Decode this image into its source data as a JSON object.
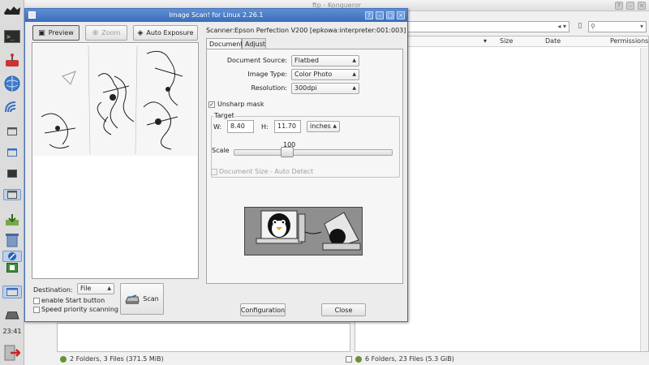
{
  "desktop": {
    "clock": "23:41",
    "panel_icons": [
      "app-icon",
      "terminal-icon",
      "joystick-icon",
      "globe-icon",
      "wifi-icon",
      "window-icon",
      "window-icon",
      "window-icon",
      "window-icon",
      "download-icon",
      "trash-icon",
      "scanner-icon",
      "browser-icon",
      "window-icon",
      "printer-icon",
      "logout-icon"
    ]
  },
  "konqueror": {
    "title": "ftp - Konqueror",
    "right_pane": {
      "columns": [
        "Size",
        "Date",
        "Permissions"
      ]
    },
    "status_left": "2 Folders, 3 Files (371.5 MiB)",
    "status_right": "6 Folders, 23 Files (5.3 GiB)"
  },
  "scan_dialog": {
    "title": "Image Scan! for Linux 2.26.1",
    "toolbar": {
      "preview": "Preview",
      "zoom": "Zoom",
      "auto_exposure": "Auto Exposure"
    },
    "scanner_label": "Scanner:",
    "scanner_value": "Epson Perfection V200 [epkowa:interpreter:001:003]",
    "tabs": [
      "Document",
      "Adjust"
    ],
    "document": {
      "source_label": "Document Source:",
      "source_value": "Flatbed",
      "type_label": "Image Type:",
      "type_value": "Color Photo",
      "resolution_label": "Resolution:",
      "resolution_value": "300dpi",
      "unsharp_label": "Unsharp mask",
      "unsharp_checked": true,
      "target_label": "Target",
      "w_label": "W:",
      "w_value": "8.40",
      "h_label": "H:",
      "h_value": "11.70",
      "unit_value": "inches",
      "scale_label": "Scale",
      "scale_value": "100",
      "autodetect_label": "Document Size - Auto Detect"
    },
    "destination_label": "Destination:",
    "destination_value": "File",
    "enable_start_label": "enable Start button",
    "speed_priority_label": "Speed priority scanning",
    "scan_button": "Scan",
    "configuration_button": "Configuration",
    "close_button": "Close"
  }
}
